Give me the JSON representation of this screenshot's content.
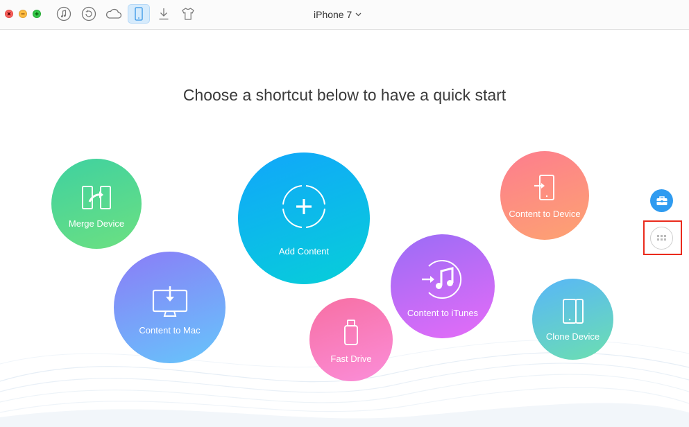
{
  "toolbar": {
    "window_controls": [
      "close",
      "minimize",
      "maximize"
    ],
    "buttons": [
      {
        "icon": "music-note-icon",
        "active": false
      },
      {
        "icon": "restore-icon",
        "active": false
      },
      {
        "icon": "cloud-icon",
        "active": false
      },
      {
        "icon": "phone-icon",
        "active": true
      },
      {
        "icon": "download-icon",
        "active": false
      },
      {
        "icon": "shirt-icon",
        "active": false
      }
    ],
    "device_name": "iPhone 7",
    "device_chevron": "⌄"
  },
  "main": {
    "heading": "Choose a shortcut below to have a quick start",
    "shortcuts": {
      "merge_device": "Merge Device",
      "content_to_mac": "Content to Mac",
      "add_content": "Add Content",
      "fast_drive": "Fast Drive",
      "content_to_itunes": "Content to iTunes",
      "content_to_device": "Content to Device",
      "clone_device": "Clone Device"
    }
  },
  "side": {
    "toolkit_icon": "toolbox-icon",
    "apps_icon": "grid-icon",
    "highlighted": "apps-button"
  },
  "colors": {
    "accent": "#2f9bf0",
    "highlight_border": "#ea2a1c",
    "active_tab_bg": "#d6ebfc"
  }
}
